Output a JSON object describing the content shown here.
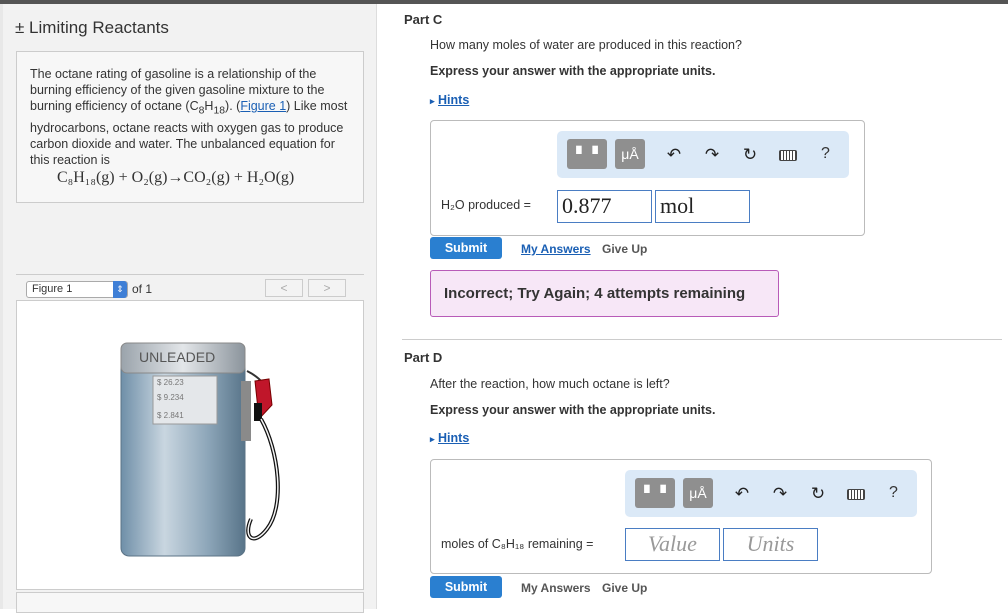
{
  "left": {
    "title": "± Limiting Reactants",
    "intro_pre": "The octane rating of gasoline is a relationship of the burning efficiency of the given gasoline mixture to the burning efficiency of octane (C",
    "intro_sub1": "8",
    "intro_mid": "H",
    "intro_sub2": "18",
    "intro_post1": "). (",
    "figure_link": "Figure 1",
    "intro_post2": ") Like most hydrocarbons, octane reacts with oxygen gas to produce carbon dioxide and water. The unbalanced equation for this reaction is",
    "equation": "C₈H₁₈(g) + O₂(g)→CO₂(g) + H₂O(g)",
    "figure_select": "Figure 1",
    "figure_of": "of 1",
    "prev_label": "<",
    "next_label": ">",
    "pump": {
      "label": "UNLEADED",
      "line1": "$ 26.23",
      "line2": "$ 9.234",
      "line3": "$ 2.841"
    }
  },
  "partC": {
    "label": "Part C",
    "question": "How many moles of water are produced in this reaction?",
    "instruction": "Express your answer with the appropriate units.",
    "hints": "Hints",
    "input_label": "H₂O produced =",
    "value": "0.877",
    "units": "mol",
    "submit": "Submit",
    "my_answers": "My Answers",
    "give_up": "Give Up",
    "feedback": "Incorrect; Try Again; 4 attempts remaining"
  },
  "partD": {
    "label": "Part D",
    "question": "After the reaction, how much octane is left?",
    "instruction": "Express your answer with the appropriate units.",
    "hints": "Hints",
    "input_label": "moles of C₈H₁₈ remaining =",
    "value_placeholder": "Value",
    "units_placeholder": "Units",
    "submit": "Submit",
    "my_answers": "My Answers",
    "give_up": "Give Up"
  },
  "toolbar": {
    "mu_label": "μÅ",
    "help": "?"
  }
}
